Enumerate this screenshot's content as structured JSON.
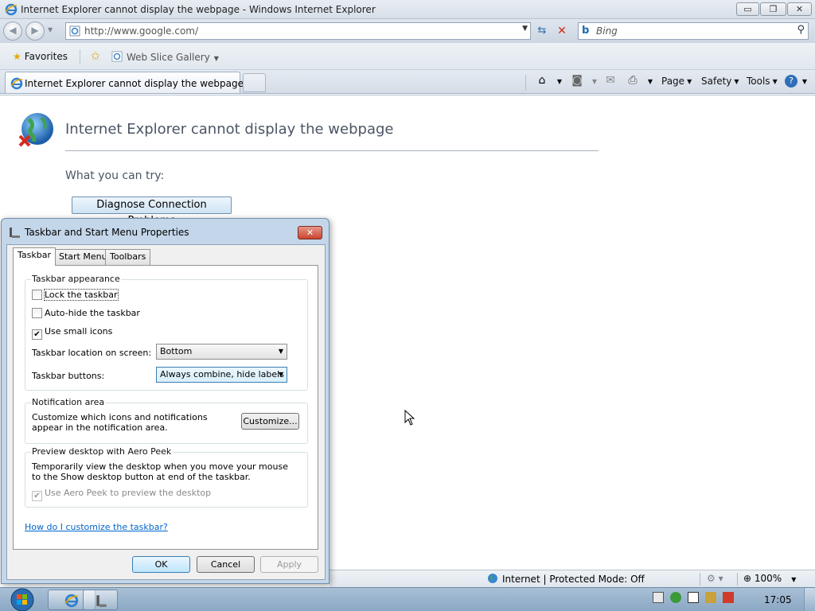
{
  "window": {
    "title": "Internet Explorer cannot display the webpage - Windows Internet Explorer",
    "minimize": "▭",
    "maximize": "❐",
    "close": "✕"
  },
  "address_bar": {
    "url": "http://www.google.com/",
    "search_placeholder": "Bing"
  },
  "favorites_bar": {
    "favorites_label": "Favorites",
    "web_slice_gallery": "Web Slice Gallery"
  },
  "tabs": [
    {
      "label": "Internet Explorer cannot display the webpage"
    }
  ],
  "command_bar": {
    "page": "Page",
    "safety": "Safety",
    "tools": "Tools"
  },
  "page": {
    "title": "Internet Explorer cannot display the webpage",
    "what_you_can_try": "What you can try:",
    "diagnose_button": "Diagnose Connection Problems"
  },
  "status_bar": {
    "zone": "Internet | Protected Mode: Off",
    "zoom": "100%"
  },
  "dialog": {
    "title": "Taskbar and Start Menu Properties",
    "tabs": [
      "Taskbar",
      "Start Menu",
      "Toolbars"
    ],
    "appearance": {
      "label": "Taskbar appearance",
      "lock_taskbar": "Lock the taskbar",
      "lock_taskbar_checked": false,
      "auto_hide": "Auto-hide the taskbar",
      "auto_hide_checked": false,
      "small_icons": "Use small icons",
      "small_icons_checked": true,
      "location_label": "Taskbar location on screen:",
      "location_value": "Bottom",
      "buttons_label": "Taskbar buttons:",
      "buttons_value": "Always combine, hide labels"
    },
    "notification": {
      "label": "Notification area",
      "text": "Customize which icons and notifications appear in the notification area.",
      "customize_button": "Customize..."
    },
    "aero_peek": {
      "label": "Preview desktop with Aero Peek",
      "text": "Temporarily view the desktop when you move your mouse to the Show desktop button at end of the taskbar.",
      "checkbox": "Use Aero Peek to preview the desktop",
      "checkbox_checked": true,
      "checkbox_disabled": true
    },
    "help_link": "How do I customize the taskbar?",
    "buttons": {
      "ok": "OK",
      "cancel": "Cancel",
      "apply": "Apply"
    }
  },
  "taskbar": {
    "clock": "17:05"
  },
  "colors": {
    "link": "#0066cc",
    "title_text": "#4b5564",
    "taskbar": "#9bb4cd",
    "close_red": "#c94430"
  }
}
